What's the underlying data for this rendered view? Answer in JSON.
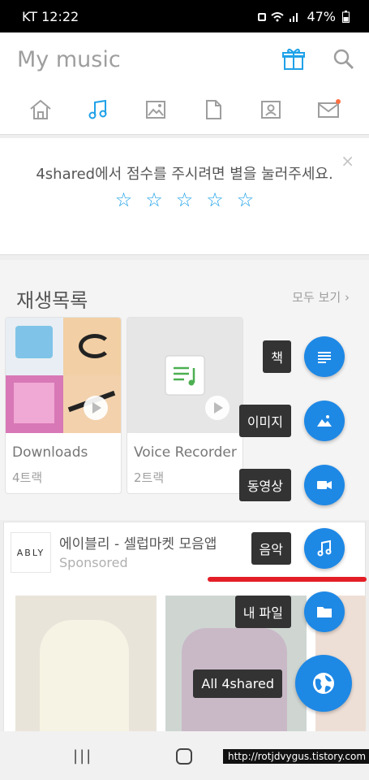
{
  "status_bar": {
    "carrier_time": "KT  12:22",
    "battery": "47%"
  },
  "header": {
    "title": "My music",
    "gift_icon": "gift-icon",
    "search_icon": "search-icon"
  },
  "tabs": [
    {
      "name": "home-icon"
    },
    {
      "name": "music-icon",
      "active": true
    },
    {
      "name": "image-icon"
    },
    {
      "name": "file-icon"
    },
    {
      "name": "contact-icon"
    },
    {
      "name": "mail-icon"
    }
  ],
  "rating": {
    "text": "4shared에서 점수를 주시려면 별을 눌러주세요.",
    "close": "×",
    "stars": [
      "☆",
      "☆",
      "☆",
      "☆",
      "☆"
    ]
  },
  "playlists": {
    "title": "재생목록",
    "see_all": "모두 보기 ›",
    "items": [
      {
        "name": "Downloads",
        "count": "4트랙"
      },
      {
        "name": "Voice Recorder",
        "count": "2트랙"
      }
    ]
  },
  "ad": {
    "logo": "ABLY",
    "title": "에이블리 - 셀럽마켓 모음앱",
    "subtitle": "Sponsored"
  },
  "fab_menu": {
    "items": [
      {
        "label": "책",
        "icon": "book-icon"
      },
      {
        "label": "이미지",
        "icon": "image-icon"
      },
      {
        "label": "동영상",
        "icon": "video-icon"
      },
      {
        "label": "음악",
        "icon": "music-icon"
      },
      {
        "label": "내 파일",
        "icon": "folder-icon"
      }
    ],
    "main_label": "All 4shared",
    "main_icon": "globe-icon"
  },
  "nav": {
    "recents": "|||",
    "watermark": "http://rotjdvygus.tistory.com"
  },
  "colors": {
    "accent": "#1e88e5",
    "tab_active": "#1fa1e8",
    "highlight": "#e41e26"
  }
}
